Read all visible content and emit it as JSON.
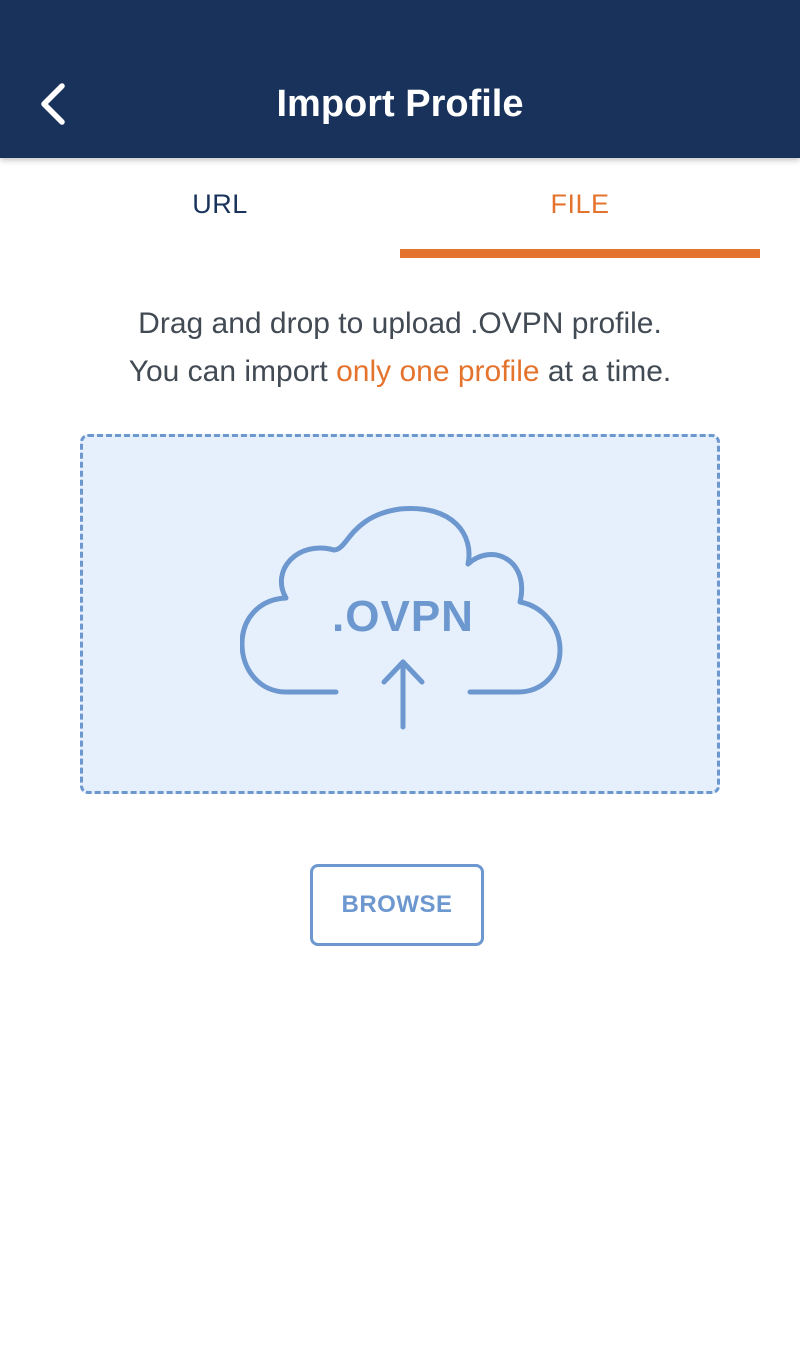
{
  "header": {
    "title": "Import Profile",
    "back_icon": "chevron-left-icon"
  },
  "tabs": [
    {
      "label": "URL",
      "active": false
    },
    {
      "label": "FILE",
      "active": true
    }
  ],
  "instructions": {
    "line1": "Drag and drop to upload .OVPN profile.",
    "line2_before": "You can import ",
    "line2_highlight": "only one profile",
    "line2_after": " at a time."
  },
  "dropzone": {
    "icon": "cloud-upload-icon",
    "icon_text": ".OVPN"
  },
  "browse_button": {
    "label": "BROWSE"
  },
  "colors": {
    "header_bg": "#19325b",
    "accent_orange": "#e4732e",
    "accent_blue": "#6d97cf",
    "dropzone_bg": "#e6f0fd",
    "text_gray": "#424a54"
  }
}
